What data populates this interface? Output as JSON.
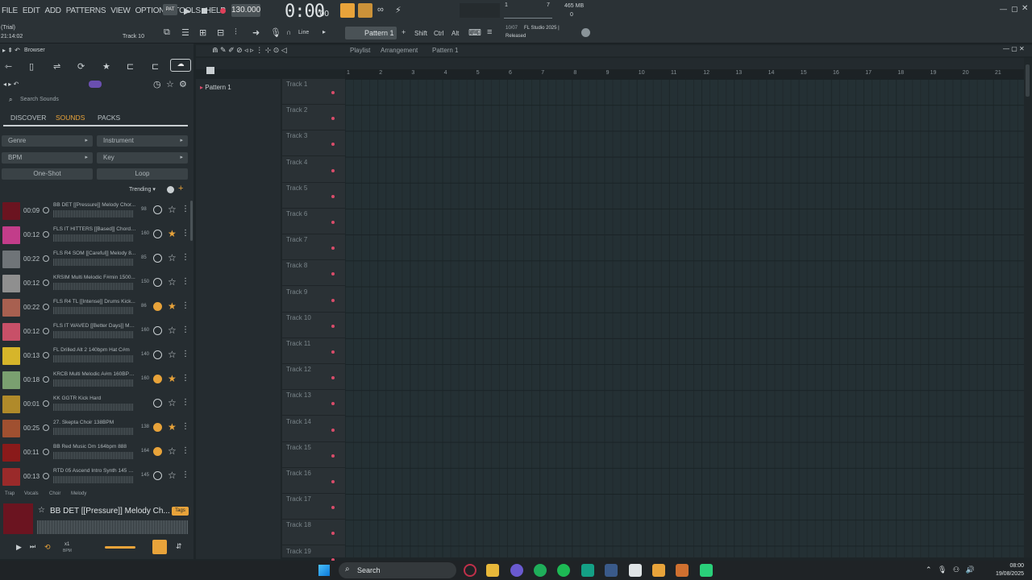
{
  "menu": [
    "FILE",
    "EDIT",
    "ADD",
    "PATTERNS",
    "VIEW",
    "OPTIONS",
    "TOOLS",
    "HELP"
  ],
  "transport": {
    "tempo": "130.000",
    "time": "0:00",
    "time_sub": ":00",
    "mem": "465 MB",
    "mem_sub": "0",
    "cpu_top": "7",
    "cpu_left": "1"
  },
  "status": {
    "trial": "(Trial)",
    "clock": "21:14:02",
    "track": "Track 10"
  },
  "toolbar": {
    "snap": "Line",
    "pattern": "Pattern 1",
    "shift": "Shift",
    "ctrl": "Ctrl",
    "alt": "Alt",
    "news_date": "10/07",
    "news_line1": "FL Studio 2025 |",
    "news_line2": "Released"
  },
  "browser": {
    "title": "Browser",
    "search_placeholder": "Search Sounds",
    "tabs": [
      "DISCOVER",
      "SOUNDS",
      "PACKS"
    ],
    "filters": [
      "Genre",
      "Instrument",
      "BPM",
      "Key"
    ],
    "modes": [
      "One-Shot",
      "Loop"
    ],
    "sort": "Trending",
    "footer_tags": [
      "Trap",
      "Vocals",
      "Choir",
      "Melody"
    ],
    "items": [
      {
        "dur": "00:09",
        "name": "BB DET [[Pressure]] Melody Chor...",
        "bpm": "98",
        "added": false,
        "starred": false,
        "color": "#6b1420"
      },
      {
        "dur": "00:12",
        "name": "FLS IT HITTERS [[Based]] Chord P...",
        "bpm": "160",
        "added": false,
        "starred": true,
        "color": "#c23d8a"
      },
      {
        "dur": "00:22",
        "name": "FLS R4 SOM [[Careful]] Melody 8...",
        "bpm": "85",
        "added": false,
        "starred": false,
        "color": "#6f7478"
      },
      {
        "dur": "00:12",
        "name": "KRSIM Multi Melodic F#min 1500...",
        "bpm": "150",
        "added": false,
        "starred": false,
        "color": "#8f8f8f"
      },
      {
        "dur": "00:22",
        "name": "FLS R4 TL [[Intense]] Drums Kick...",
        "bpm": "86",
        "added": true,
        "starred": true,
        "color": "#a86050"
      },
      {
        "dur": "00:12",
        "name": "FLS IT WAVED [[Better Days]] Melo...",
        "bpm": "160",
        "added": false,
        "starred": false,
        "color": "#c85068"
      },
      {
        "dur": "00:13",
        "name": "FL Drilled Alt 2 140bpm Hat C#m",
        "bpm": "140",
        "added": false,
        "starred": false,
        "color": "#d6b52a"
      },
      {
        "dur": "00:18",
        "name": "KRCB Multi Melodic A#m 160BPM ...",
        "bpm": "160",
        "added": true,
        "starred": true,
        "color": "#7aa070"
      },
      {
        "dur": "00:01",
        "name": "KK GGTR Kick Hard",
        "bpm": "",
        "added": false,
        "starred": false,
        "color": "#b08a2a"
      },
      {
        "dur": "00:25",
        "name": "27. Skepta Choir 138BPM",
        "bpm": "138",
        "added": true,
        "starred": true,
        "color": "#a05030"
      },
      {
        "dur": "00:11",
        "name": "BB Red Music Dm 164bpm 888",
        "bpm": "164",
        "added": true,
        "starred": false,
        "color": "#8a1a1a"
      },
      {
        "dur": "00:13",
        "name": "RTD 05 Ascend Intro Synth 145 C#m",
        "bpm": "145",
        "added": false,
        "starred": false,
        "color": "#9a2a2a"
      }
    ],
    "preview": {
      "name": "BB DET [[Pressure]] Melody Ch...",
      "tag": "Tags",
      "speed": "x1",
      "speed_label": "BPM"
    }
  },
  "playlist": {
    "title": "Playlist",
    "crumb1": "Arrangement",
    "crumb2": "Pattern 1",
    "pattern_item": "Pattern 1",
    "tracks": [
      "Track 1",
      "Track 2",
      "Track 3",
      "Track 4",
      "Track 5",
      "Track 6",
      "Track 7",
      "Track 8",
      "Track 9",
      "Track 10",
      "Track 11",
      "Track 12",
      "Track 13",
      "Track 14",
      "Track 15",
      "Track 16",
      "Track 17",
      "Track 18",
      "Track 19"
    ],
    "ruler": [
      "1",
      "2",
      "3",
      "4",
      "5",
      "6",
      "7",
      "8",
      "9",
      "10",
      "11",
      "12",
      "13",
      "14",
      "15",
      "16",
      "17",
      "18",
      "19",
      "20",
      "21"
    ]
  },
  "taskbar": {
    "search": "Search",
    "time": "08:00",
    "date": "19/08/2025"
  },
  "colors": {
    "accent": "#e8a33a",
    "track_dot": "#d94c6a",
    "sounds_tab": "#e8a33a"
  }
}
